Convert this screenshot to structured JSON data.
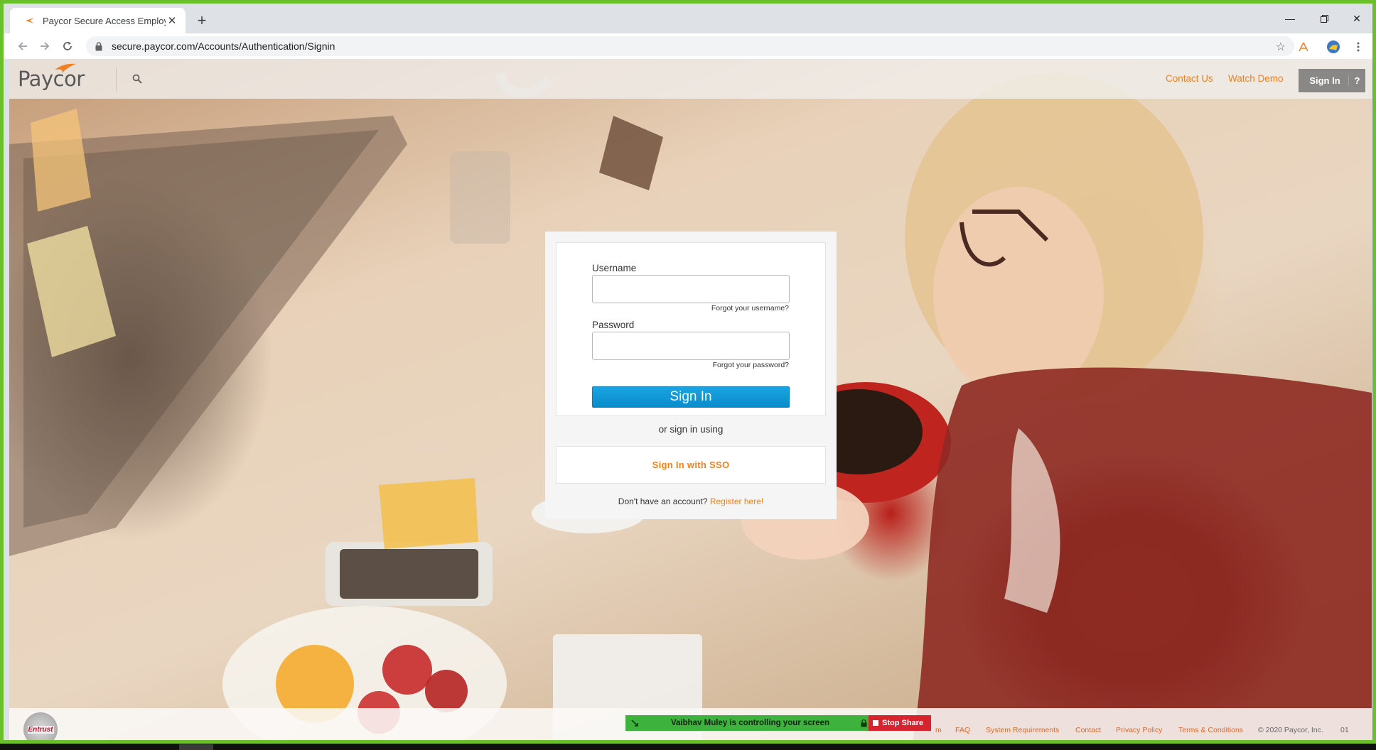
{
  "browser": {
    "tab_title": "Paycor Secure Access Employee",
    "url": "secure.paycor.com/Accounts/Authentication/Signin"
  },
  "header": {
    "logo_text": "Paycor",
    "contact_us": "Contact Us",
    "watch_demo": "Watch Demo",
    "sign_in": "Sign In",
    "help": "?"
  },
  "login": {
    "username_label": "Username",
    "username_value": "",
    "forgot_username": "Forgot your username?",
    "password_label": "Password",
    "password_value": "",
    "forgot_password": "Forgot your password?",
    "sign_in_button": "Sign In",
    "or_text": "or sign in using",
    "sso_button": "Sign In with SSO",
    "no_account_text": "Don't have an account?",
    "register_link": "Register here!"
  },
  "footer": {
    "entrust_text": "Entrust",
    "partial_link": "m",
    "links": [
      "FAQ",
      "System Requirements",
      "Contact",
      "Privacy Policy",
      "Terms & Conditions"
    ],
    "copyright": "© 2020 Paycor, Inc.",
    "trailing": "01"
  },
  "screen_share": {
    "message": "Vaibhav Muley is controlling your screen",
    "stop_label": "Stop Share"
  },
  "colors": {
    "brand_orange": "#f08123",
    "sign_in_blue": "#1aa3e2",
    "share_green": "#3db33d",
    "stop_red": "#d6232d"
  }
}
